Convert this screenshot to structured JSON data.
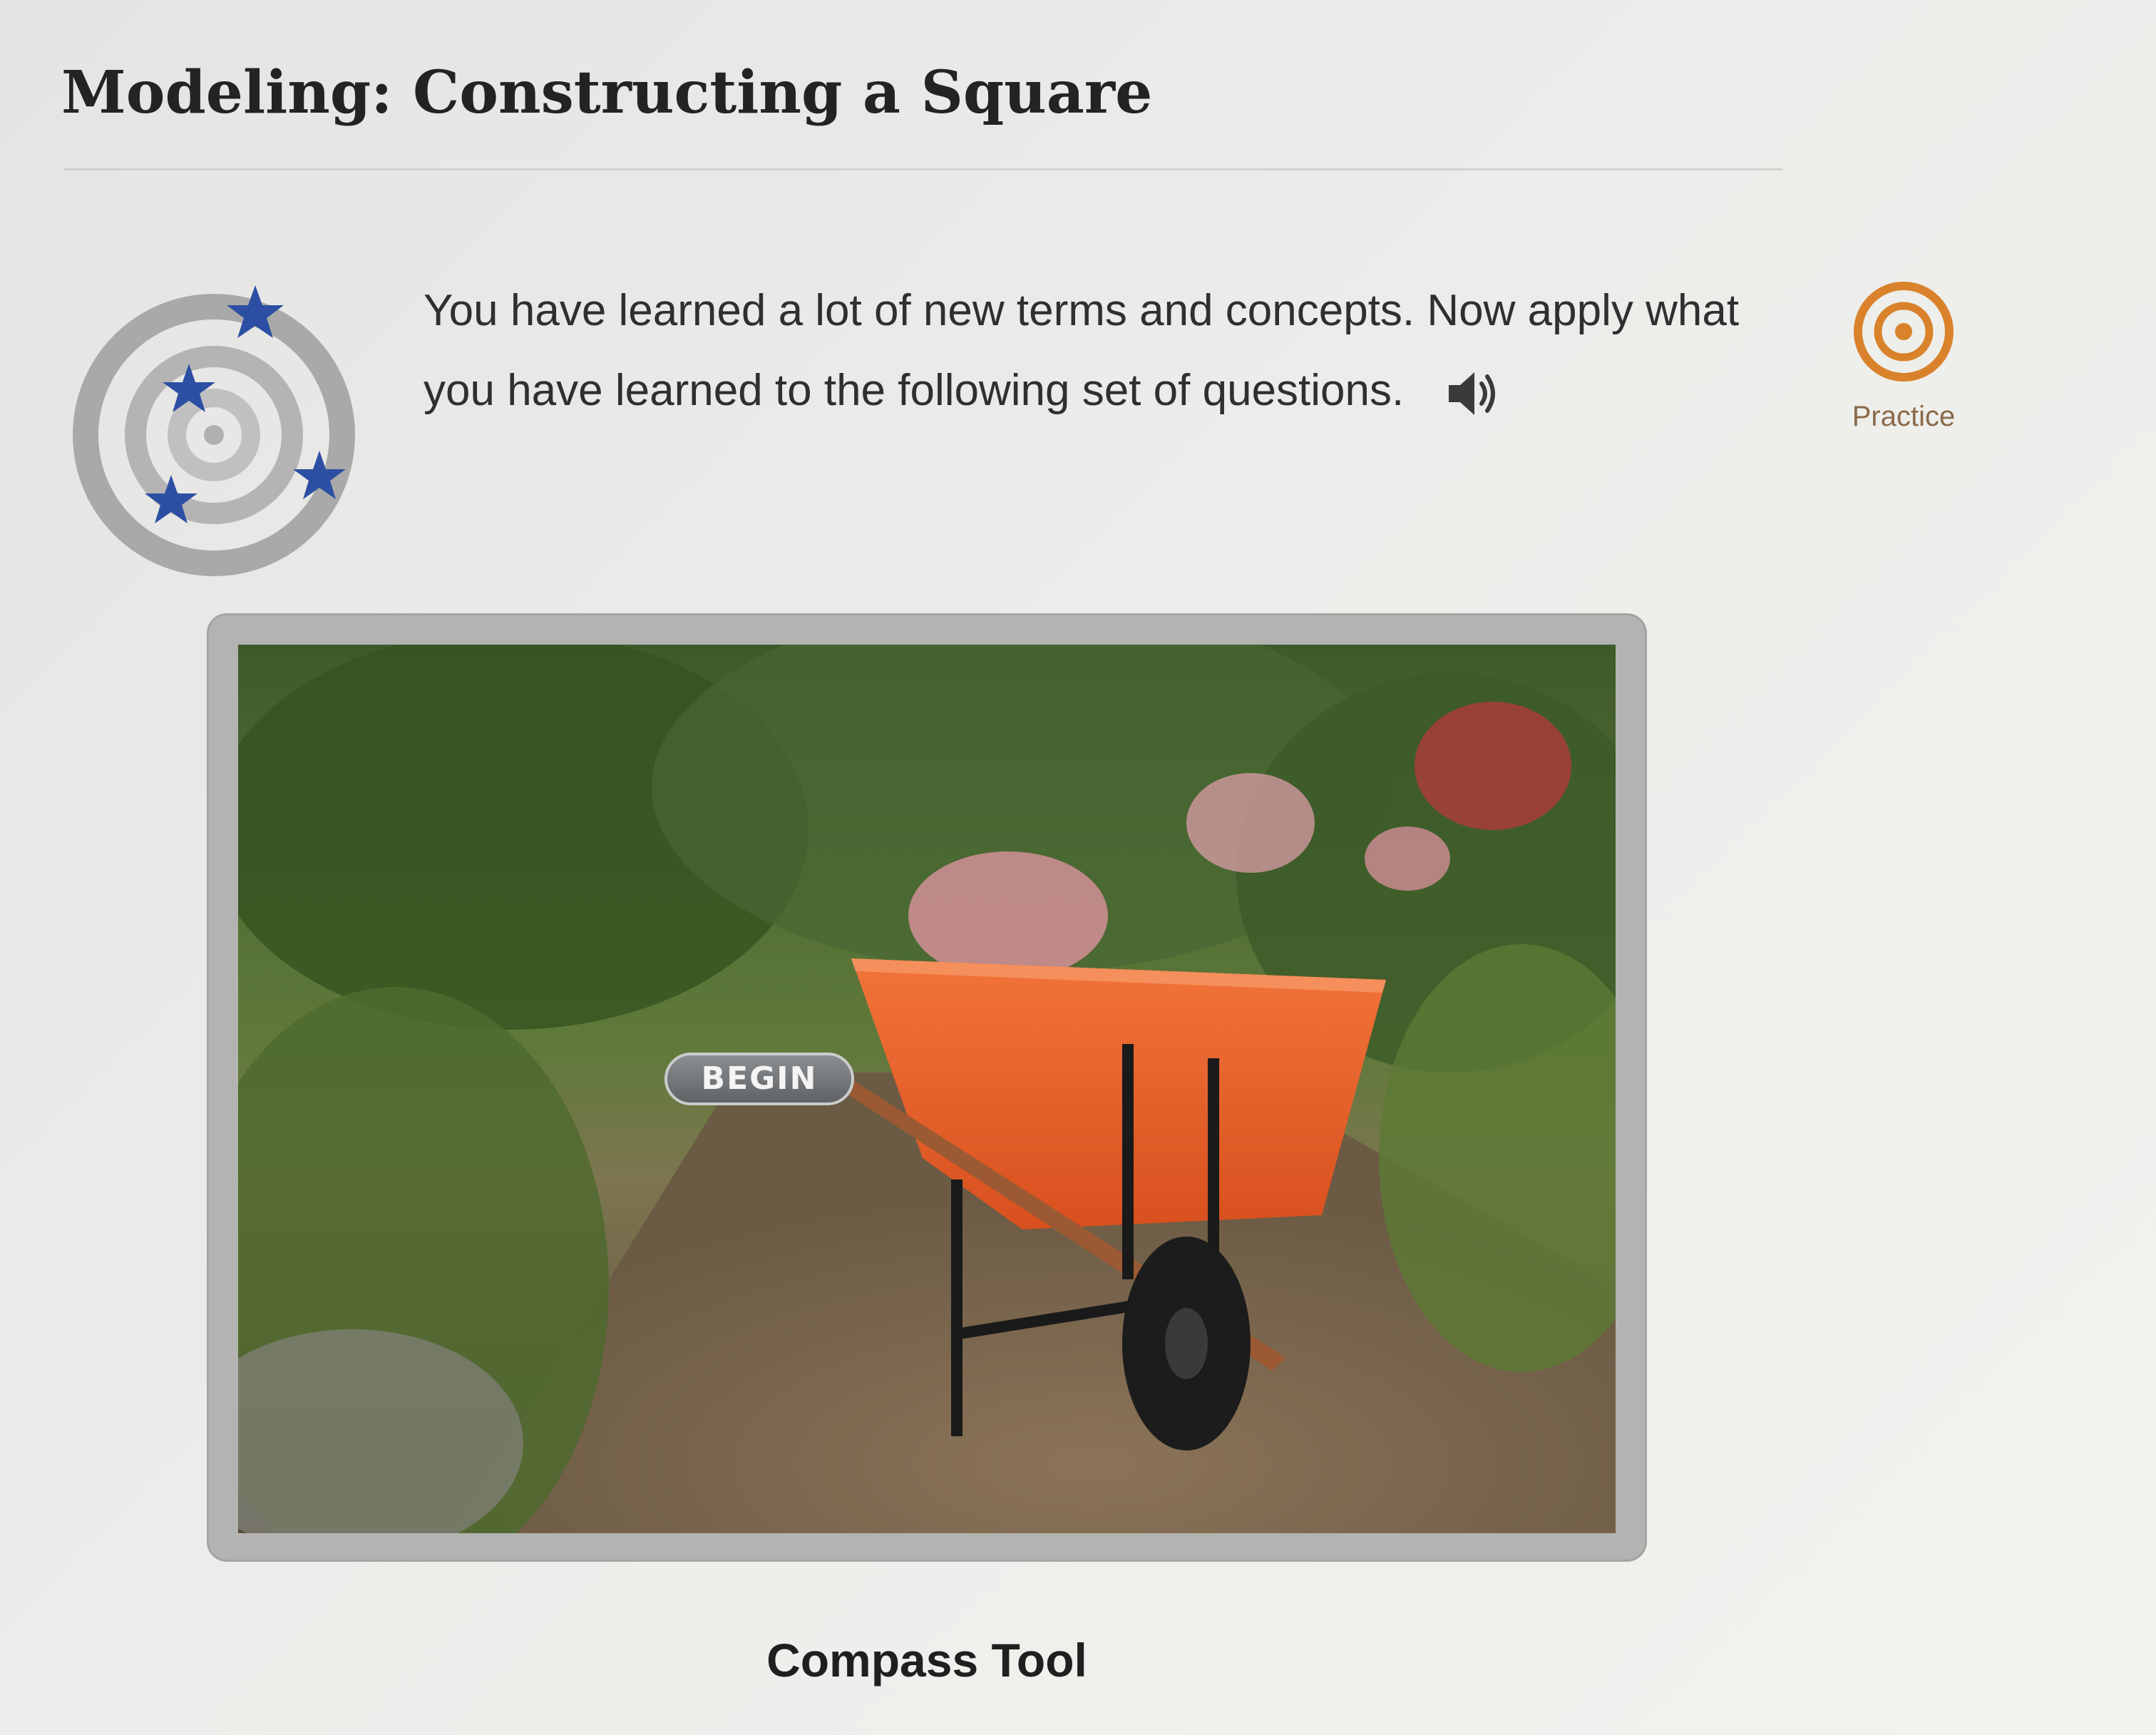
{
  "page": {
    "title": "Modeling: Constructing a Square"
  },
  "intro": {
    "text": "You have learned a lot of new terms and concepts. Now apply what you have learned to the following set of questions.",
    "audio_icon": "speaker-icon"
  },
  "badge": {
    "icon": "target-with-stars-icon",
    "star_color": "#2c4fa3",
    "ring_color": "#a8a8a8"
  },
  "practice": {
    "label": "Practice",
    "icon": "target-icon",
    "color": "#d9822b"
  },
  "media": {
    "begin_label": "BEGIN",
    "image_subject": "orange wheelbarrow on a garden path"
  },
  "caption": {
    "text": "Compass Tool"
  }
}
